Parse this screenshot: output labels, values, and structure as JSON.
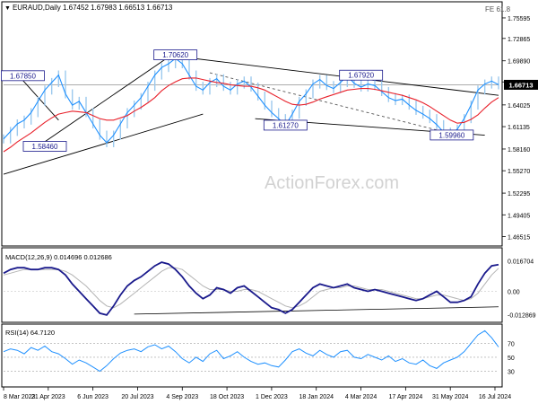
{
  "header": {
    "symbol": "EURAUD,Daily",
    "ohlc": "1.67452 1.67983 1.66513 1.66713",
    "corner_note": "FE 61.8"
  },
  "watermark": "ActionForex.com",
  "chart_data": [
    {
      "type": "line",
      "panel": "price",
      "description_series": [
        "close",
        "55-day moving average"
      ],
      "colors": {
        "close": "#1e90ff",
        "ma": "#e8202a",
        "current_line": "#7a7a7a"
      },
      "current_price_label": "1.66713",
      "y_tick_labels": [
        "1.75595",
        "1.72865",
        "1.69890",
        "1.67082",
        "1.64025",
        "1.61135",
        "1.58160",
        "1.55270",
        "1.52295",
        "1.49405",
        "1.46515"
      ],
      "ylim": [
        1.455,
        1.775
      ],
      "x_tick_labels": [
        "8 Mar 2023",
        "21 Apr 2023",
        "6 Jun 2023",
        "20 Jul 2023",
        "4 Sep 2023",
        "18 Oct 2023",
        "1 Dec 2023",
        "18 Jan 2024",
        "4 Mar 2024",
        "17 Apr 2024",
        "31 May 2024",
        "16 Jul 2024"
      ],
      "x": [
        0,
        5,
        10,
        15,
        20,
        25,
        30,
        35,
        40,
        45,
        50,
        55,
        60,
        65,
        70,
        75,
        80,
        85,
        90,
        95,
        100,
        105,
        110,
        115,
        120,
        125,
        130,
        135,
        140,
        145,
        150,
        155,
        160,
        165,
        170,
        175,
        180,
        185,
        190,
        195,
        200,
        205,
        210,
        215,
        220,
        225,
        230,
        235,
        240,
        245,
        250,
        255,
        260,
        265,
        270,
        275,
        280,
        285,
        290,
        295,
        300,
        305,
        310,
        315,
        320,
        325,
        330,
        335,
        340,
        345,
        350,
        355,
        360
      ],
      "close": [
        1.595,
        1.605,
        1.615,
        1.62,
        1.63,
        1.645,
        1.66,
        1.67,
        1.68,
        1.655,
        1.64,
        1.645,
        1.63,
        1.615,
        1.6,
        1.59,
        1.6,
        1.615,
        1.63,
        1.64,
        1.65,
        1.665,
        1.68,
        1.69,
        1.695,
        1.702,
        1.695,
        1.68,
        1.665,
        1.66,
        1.67,
        1.675,
        1.665,
        1.66,
        1.668,
        1.672,
        1.664,
        1.652,
        1.64,
        1.63,
        1.622,
        1.613,
        1.628,
        1.645,
        1.655,
        1.668,
        1.674,
        1.666,
        1.662,
        1.67,
        1.679,
        1.669,
        1.664,
        1.668,
        1.666,
        1.658,
        1.65,
        1.646,
        1.648,
        1.64,
        1.633,
        1.628,
        1.622,
        1.614,
        1.604,
        1.6,
        1.608,
        1.622,
        1.64,
        1.66,
        1.668,
        1.672,
        1.667
      ],
      "ma": [
        1.578,
        1.584,
        1.591,
        1.597,
        1.603,
        1.61,
        1.617,
        1.623,
        1.628,
        1.63,
        1.632,
        1.631,
        1.63,
        1.626,
        1.622,
        1.62,
        1.62,
        1.623,
        1.626,
        1.632,
        1.637,
        1.643,
        1.65,
        1.659,
        1.666,
        1.671,
        1.675,
        1.676,
        1.676,
        1.674,
        1.672,
        1.67,
        1.669,
        1.667,
        1.666,
        1.665,
        1.665,
        1.663,
        1.66,
        1.655,
        1.65,
        1.645,
        1.641,
        1.64,
        1.641,
        1.644,
        1.648,
        1.651,
        1.654,
        1.657,
        1.66,
        1.661,
        1.662,
        1.662,
        1.661,
        1.659,
        1.657,
        1.655,
        1.653,
        1.65,
        1.647,
        1.643,
        1.638,
        1.632,
        1.626,
        1.62,
        1.616,
        1.617,
        1.621,
        1.627,
        1.636,
        1.644,
        1.65
      ],
      "annotations": [
        {
          "label": "1.67850",
          "x": 14,
          "y": 1.6785
        },
        {
          "label": "1.58460",
          "x": 30,
          "y": 1.5846
        },
        {
          "label": "1.70620",
          "x": 125,
          "y": 1.7062
        },
        {
          "label": "1.61270",
          "x": 205,
          "y": 1.6127
        },
        {
          "label": "1.67920",
          "x": 260,
          "y": 1.6792
        },
        {
          "label": "1.59960",
          "x": 326,
          "y": 1.5996
        }
      ],
      "trendlines": [
        {
          "x": [
            0,
            145
          ],
          "y": [
            1.548,
            1.628
          ]
        },
        {
          "x": [
            10,
            40
          ],
          "y": [
            1.681,
            1.62
          ]
        },
        {
          "x": [
            25,
            120
          ],
          "y": [
            1.585,
            1.704
          ]
        },
        {
          "x": [
            125,
            360
          ],
          "y": [
            1.705,
            1.653
          ]
        },
        {
          "x": [
            183,
            350
          ],
          "y": [
            1.622,
            1.6
          ]
        },
        {
          "x": [
            150,
            330
          ],
          "y": [
            1.683,
            1.6
          ],
          "dashed": true
        }
      ]
    },
    {
      "type": "line",
      "panel": "macd",
      "label": "MACD(12,26,9) 0.014696 0.012686",
      "y_tick_labels": [
        "0.016704",
        "0.00",
        "-0.012869"
      ],
      "ylim": [
        -0.016,
        0.019
      ],
      "colors": {
        "macd": "#1a1a8c",
        "signal": "#b4b4b4"
      },
      "x": [
        0,
        5,
        10,
        15,
        20,
        25,
        30,
        35,
        40,
        45,
        50,
        55,
        60,
        65,
        70,
        75,
        80,
        85,
        90,
        95,
        100,
        105,
        110,
        115,
        120,
        125,
        130,
        135,
        140,
        145,
        150,
        155,
        160,
        165,
        170,
        175,
        180,
        185,
        190,
        195,
        200,
        205,
        210,
        215,
        220,
        225,
        230,
        235,
        240,
        245,
        250,
        255,
        260,
        265,
        270,
        275,
        280,
        285,
        290,
        295,
        300,
        305,
        310,
        315,
        320,
        325,
        330,
        335,
        340,
        345,
        350,
        355,
        360
      ],
      "macd": [
        0.01,
        0.012,
        0.013,
        0.013,
        0.012,
        0.012,
        0.013,
        0.013,
        0.012,
        0.009,
        0.004,
        0.0,
        -0.004,
        -0.008,
        -0.012,
        -0.013,
        -0.008,
        -0.002,
        0.003,
        0.006,
        0.008,
        0.011,
        0.014,
        0.016,
        0.015,
        0.012,
        0.008,
        0.003,
        -0.001,
        -0.004,
        -0.002,
        0.002,
        0.001,
        -0.001,
        0.002,
        0.003,
        0.0,
        -0.003,
        -0.006,
        -0.009,
        -0.01,
        -0.012,
        -0.01,
        -0.006,
        -0.002,
        0.002,
        0.004,
        0.003,
        0.002,
        0.003,
        0.004,
        0.002,
        0.001,
        0.0,
        0.001,
        0.0,
        -0.001,
        -0.002,
        -0.003,
        -0.004,
        -0.005,
        -0.004,
        -0.002,
        0.0,
        -0.003,
        -0.006,
        -0.006,
        -0.005,
        -0.003,
        0.004,
        0.01,
        0.014,
        0.0147
      ],
      "signal": [
        0.009,
        0.01,
        0.011,
        0.012,
        0.012,
        0.012,
        0.012,
        0.012,
        0.012,
        0.011,
        0.009,
        0.006,
        0.003,
        -0.001,
        -0.005,
        -0.008,
        -0.009,
        -0.007,
        -0.004,
        -0.001,
        0.002,
        0.005,
        0.008,
        0.011,
        0.013,
        0.013,
        0.012,
        0.009,
        0.006,
        0.003,
        0.001,
        0.001,
        0.001,
        0.0,
        0.0,
        0.001,
        0.001,
        0.0,
        -0.002,
        -0.004,
        -0.006,
        -0.008,
        -0.009,
        -0.008,
        -0.006,
        -0.003,
        0.0,
        0.001,
        0.002,
        0.002,
        0.003,
        0.003,
        0.002,
        0.001,
        0.001,
        0.001,
        0.0,
        -0.001,
        -0.002,
        -0.003,
        -0.004,
        -0.004,
        -0.003,
        -0.002,
        -0.002,
        -0.003,
        -0.004,
        -0.005,
        -0.004,
        -0.001,
        0.004,
        0.009,
        0.0127
      ],
      "trendline": {
        "x": [
          95,
          360
        ],
        "y": [
          -0.0125,
          -0.0085
        ]
      }
    },
    {
      "type": "line",
      "panel": "rsi",
      "label": "RSI(14) 64.7120",
      "y_tick_labels": [
        "70",
        "50",
        "30"
      ],
      "ylim": [
        10,
        95
      ],
      "colors": {
        "rsi": "#1e90ff",
        "levels": "#a0a0a0"
      },
      "x": [
        0,
        5,
        10,
        15,
        20,
        25,
        30,
        35,
        40,
        45,
        50,
        55,
        60,
        65,
        70,
        75,
        80,
        85,
        90,
        95,
        100,
        105,
        110,
        115,
        120,
        125,
        130,
        135,
        140,
        145,
        150,
        155,
        160,
        165,
        170,
        175,
        180,
        185,
        190,
        195,
        200,
        205,
        210,
        215,
        220,
        225,
        230,
        235,
        240,
        245,
        250,
        255,
        260,
        265,
        270,
        275,
        280,
        285,
        290,
        295,
        300,
        305,
        310,
        315,
        320,
        325,
        330,
        335,
        340,
        345,
        350,
        355,
        360
      ],
      "rsi": [
        58,
        62,
        60,
        55,
        64,
        60,
        66,
        58,
        55,
        48,
        40,
        46,
        42,
        36,
        30,
        38,
        48,
        56,
        60,
        62,
        58,
        65,
        68,
        62,
        66,
        58,
        48,
        42,
        50,
        44,
        55,
        60,
        48,
        52,
        58,
        50,
        44,
        40,
        42,
        38,
        36,
        46,
        58,
        62,
        56,
        52,
        60,
        54,
        50,
        58,
        60,
        50,
        48,
        54,
        50,
        46,
        52,
        44,
        48,
        42,
        40,
        46,
        38,
        34,
        42,
        46,
        50,
        58,
        70,
        82,
        88,
        78,
        64.7
      ]
    }
  ]
}
